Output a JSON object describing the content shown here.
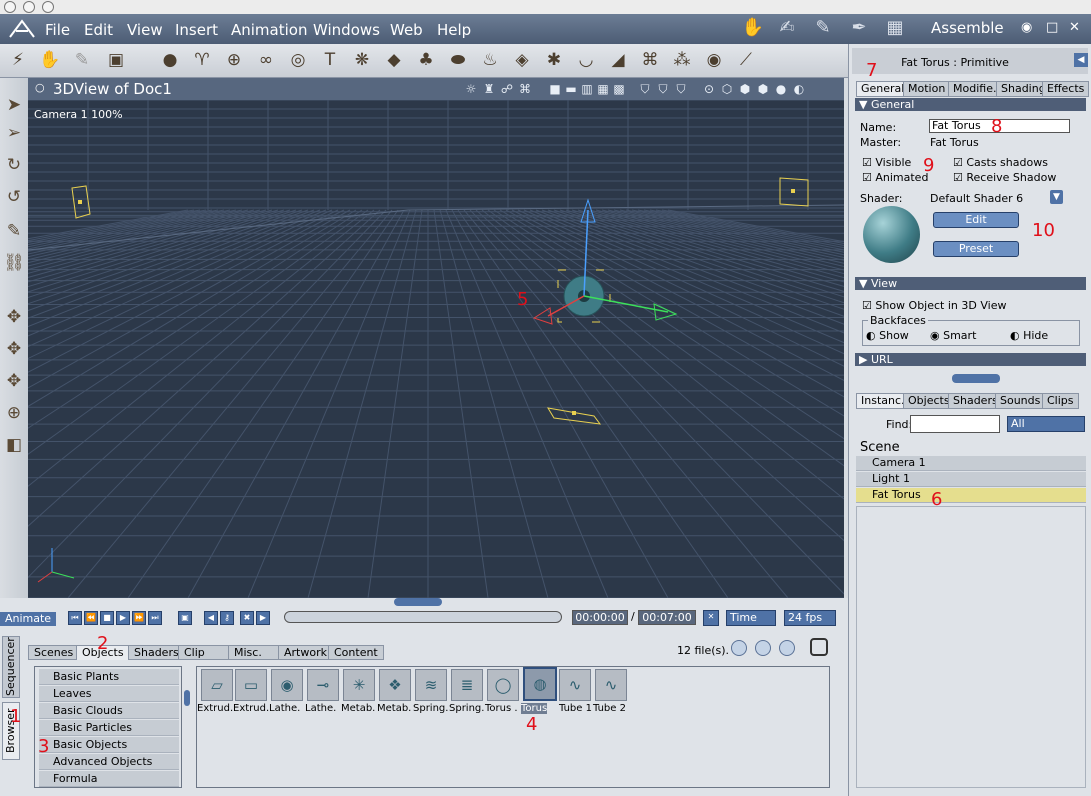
{
  "menu": {
    "items": [
      "File",
      "Edit",
      "View",
      "Insert",
      "Animation",
      "Windows",
      "Web",
      "Help"
    ],
    "room": "Assemble"
  },
  "viewport": {
    "title": "3DView of Doc1",
    "camera_label": "Camera 1 100%"
  },
  "timeline": {
    "animate": "Animate",
    "current_time": "00:00:00",
    "end_time": "00:07:00",
    "time_mode": "Time",
    "fps": "24 fps"
  },
  "browser": {
    "side_tabs": [
      "Sequencer",
      "Browser"
    ],
    "tabs": [
      "Scenes",
      "Objects",
      "Shaders",
      "Clip",
      "Misc.",
      "Artwork",
      "Content"
    ],
    "file_count": "12 file(s).",
    "categories": [
      "Basic Plants",
      "Leaves",
      "Basic Clouds",
      "Basic Particles",
      "Basic Objects",
      "Advanced Objects",
      "Formula"
    ],
    "thumbs": [
      "Extrud.",
      "Extrud.",
      "Lathe.",
      "Lathe.",
      "Metab.",
      "Metab.",
      "Spring.",
      "Spring.",
      "Torus .",
      "Torus",
      "Tube 1",
      "Tube 2"
    ]
  },
  "properties": {
    "title": "Fat Torus : Primitive",
    "tabs": [
      "General",
      "Motion",
      "Modifie.",
      "Shading",
      "Effects"
    ],
    "general_header": "General",
    "name_label": "Name:",
    "name_value": "Fat Torus",
    "master_label": "Master:",
    "master_value": "Fat Torus",
    "visible": "Visible",
    "casts_shadows": "Casts shadows",
    "animated": "Animated",
    "receive_shadow": "Receive Shadow",
    "shader_label": "Shader:",
    "shader_value": "Default Shader 6",
    "edit": "Edit",
    "preset": "Preset",
    "view_header": "View",
    "show_object": "Show Object in 3D View",
    "backfaces": "Backfaces",
    "bf_show": "Show",
    "bf_smart": "Smart",
    "bf_hide": "Hide",
    "url_header": "URL"
  },
  "instances": {
    "tabs": [
      "Instanc.",
      "Objects",
      "Shaders",
      "Sounds",
      "Clips"
    ],
    "find_label": "Find:",
    "find_value": "",
    "filter": "All",
    "scene_header": "Scene",
    "items": [
      "Camera 1",
      "Light 1",
      "Fat Torus"
    ]
  },
  "annotations": [
    "1",
    "2",
    "3",
    "4",
    "5",
    "6",
    "7",
    "8",
    "9",
    "10"
  ]
}
